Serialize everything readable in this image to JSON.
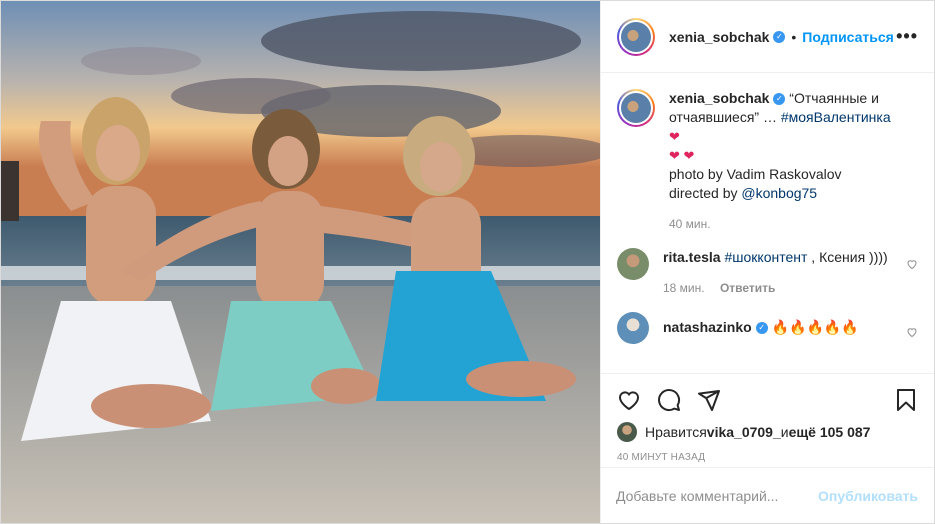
{
  "header": {
    "username": "xenia_sobchak",
    "separator": "•",
    "follow_label": "Подписаться",
    "more_label": "•••"
  },
  "caption": {
    "username": "xenia_sobchak",
    "text_prefix": " “Отчаянные и отчаявшиеся” … ",
    "hashtag": "#мояВалентинка",
    "line2": "photo by Vadim Raskovalov",
    "line3_prefix": "directed by ",
    "mention": "@konbog75",
    "time": "40 мин."
  },
  "comments": [
    {
      "username": "rita.tesla",
      "hashtag": "#шокконтент",
      "text": " , Ксения ))))",
      "time": "18 мин.",
      "reply_label": "Ответить"
    },
    {
      "username": "natashazinko",
      "text": "🔥🔥🔥🔥🔥"
    }
  ],
  "likes": {
    "prefix": "Нравится ",
    "user": "vika_0709_",
    "middle": " и ",
    "count": "ещё 105 087"
  },
  "posted_ago": "40 минут назад",
  "add_comment": {
    "placeholder": "Добавьте комментарий...",
    "publish_label": "Опубликовать"
  },
  "colors": {
    "link_blue": "#0095f6",
    "verified_blue": "#3897f0",
    "publish_disabled": "#b2dffc",
    "heart_red": "#e0245e"
  },
  "icons": [
    "heart-icon",
    "comment-icon",
    "share-icon",
    "bookmark-icon",
    "verified-badge-icon",
    "more-icon"
  ]
}
